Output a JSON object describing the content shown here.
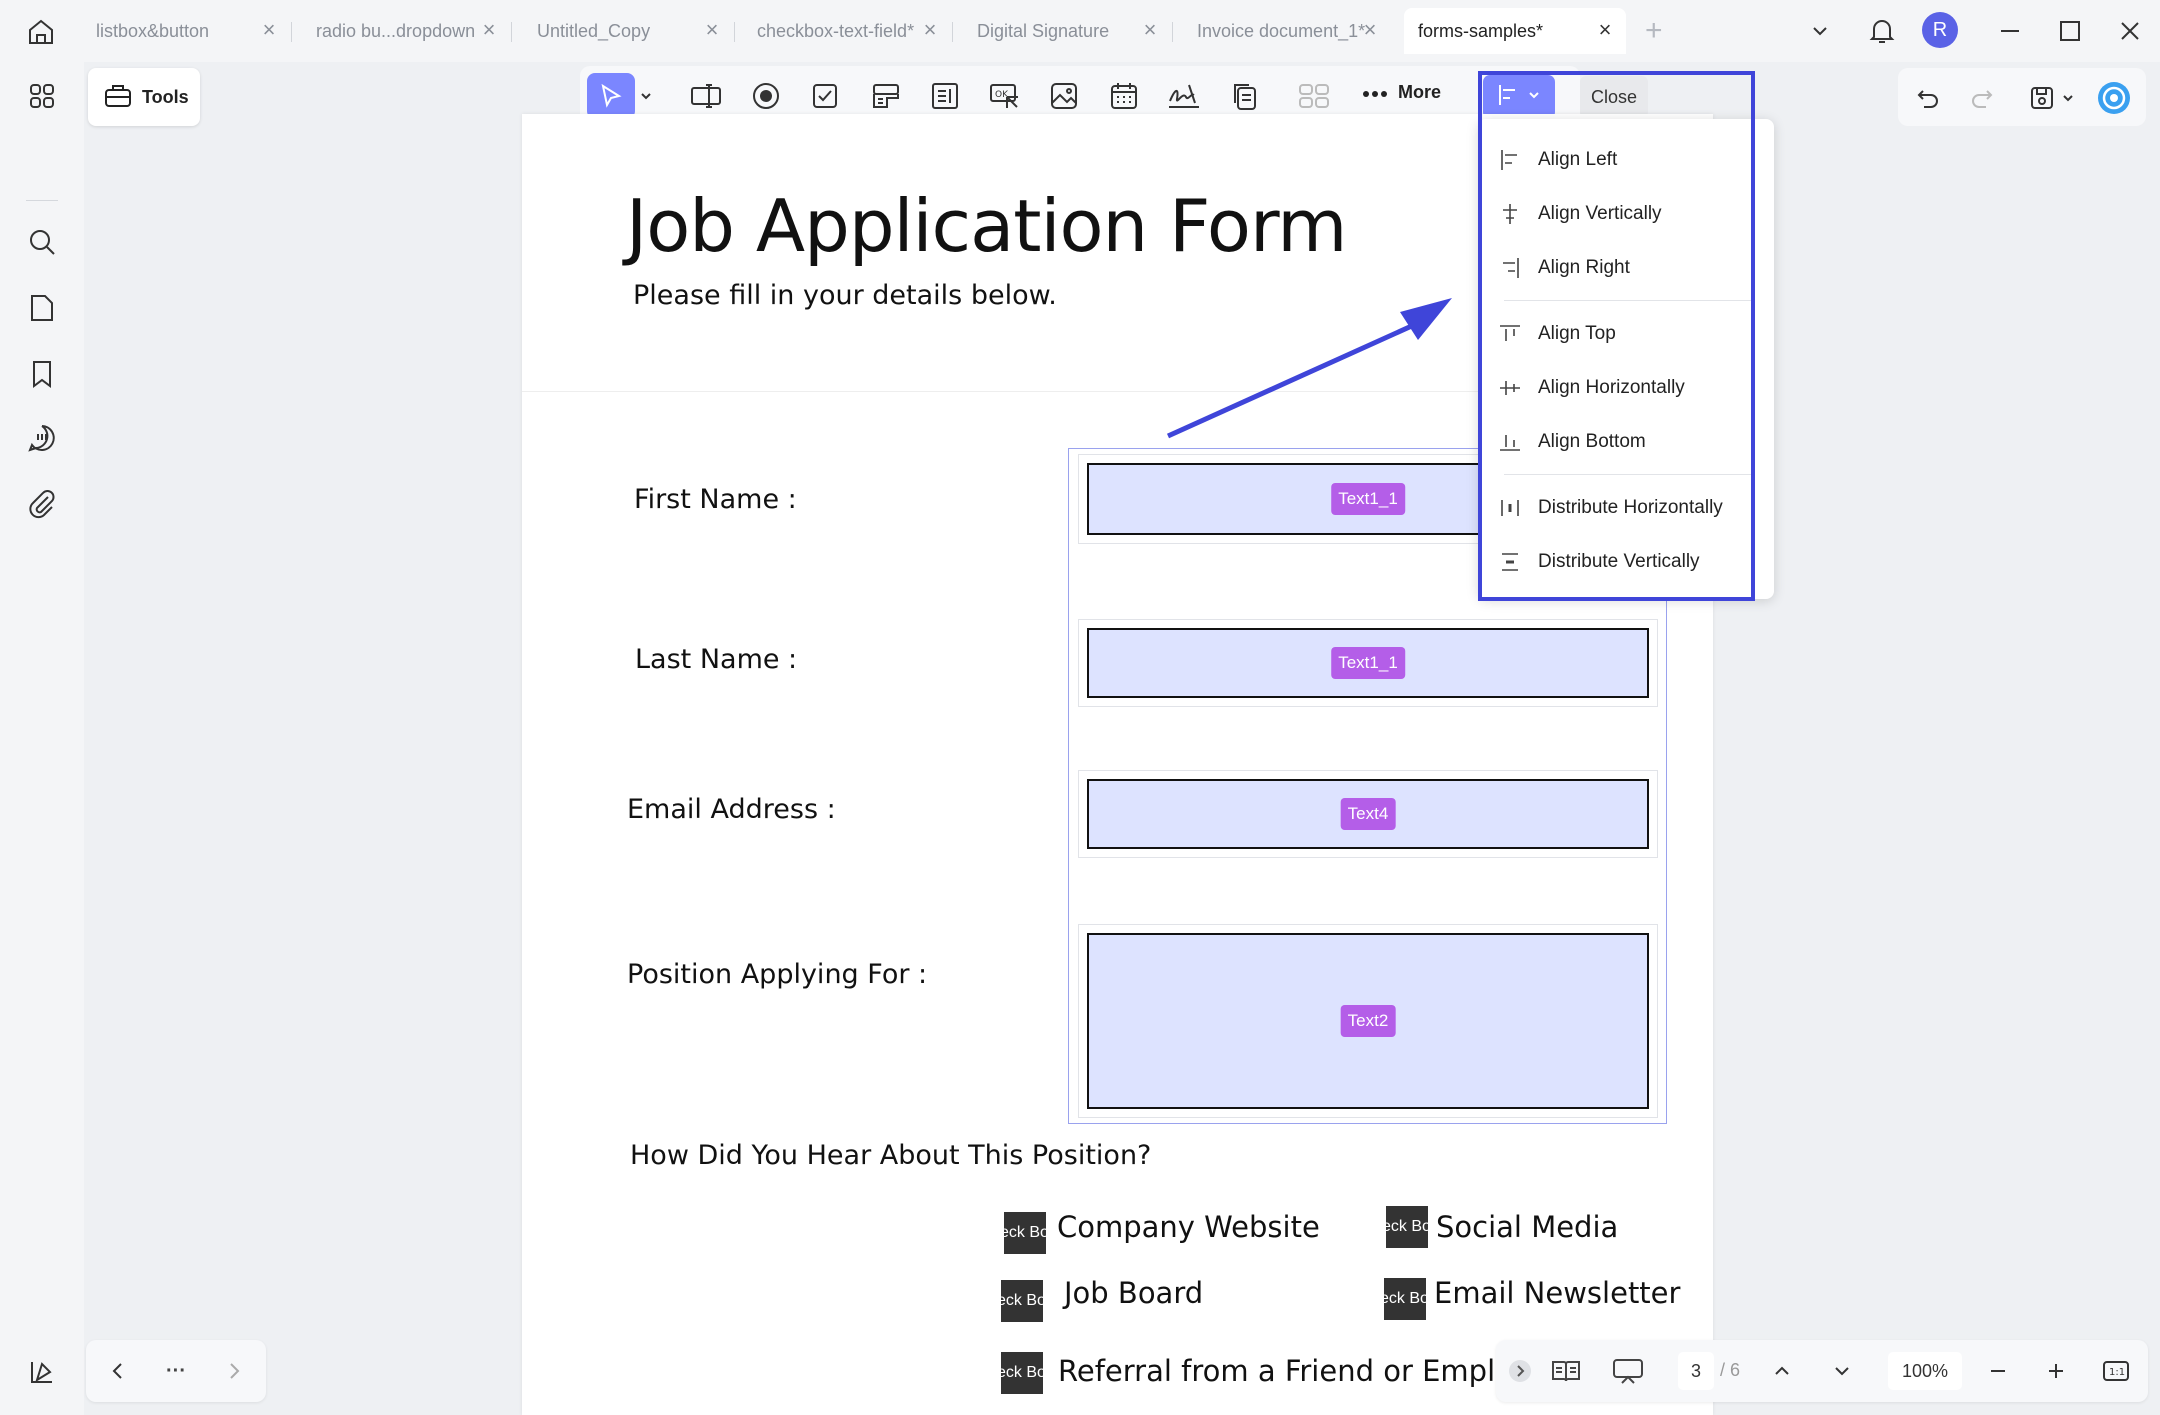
{
  "tabs": [
    {
      "label": "listbox&button",
      "active": false
    },
    {
      "label": "radio bu...dropdown",
      "active": false
    },
    {
      "label": "Untitled_Copy",
      "active": false
    },
    {
      "label": "checkbox-text-field*",
      "active": false
    },
    {
      "label": "Digital Signature",
      "active": false
    },
    {
      "label": "Invoice document_1*",
      "active": false
    },
    {
      "label": "forms-samples*",
      "active": true
    }
  ],
  "user": {
    "avatar_letter": "R"
  },
  "toolbar": {
    "tools_label": "Tools",
    "more_label": "More",
    "close_label": "Close"
  },
  "document": {
    "title": "Job Application Form",
    "subtitle": "Please fill in your details below.",
    "fields": [
      {
        "label": "First Name :",
        "tag": "Text1_1"
      },
      {
        "label": "Last Name :",
        "tag": "Text1_1"
      },
      {
        "label": "Email Address :",
        "tag": "Text4"
      },
      {
        "label": "Position Applying For :",
        "tag": "Text2"
      }
    ],
    "question": "How Did You Hear About This Position?",
    "checkbox_tag": "eck Bo",
    "options": [
      "Company Website",
      "Social Media",
      "Job Board",
      "Email Newsletter",
      "Referral from a Friend or Employee"
    ]
  },
  "align_menu": {
    "group1": [
      "Align Left",
      "Align Vertically",
      "Align Right"
    ],
    "group2": [
      "Align Top",
      "Align Horizontally",
      "Align Bottom"
    ],
    "group3": [
      "Distribute Horizontally",
      "Distribute Vertically"
    ]
  },
  "bottom_bar": {
    "nav_more": "···",
    "current_page": "3",
    "total_pages": "/ 6",
    "zoom": "100%"
  },
  "colors": {
    "accent": "#7b86ff",
    "highlight_border": "#3f45d9",
    "field_fill": "#dde3ff",
    "field_tag": "#b45ee8"
  }
}
